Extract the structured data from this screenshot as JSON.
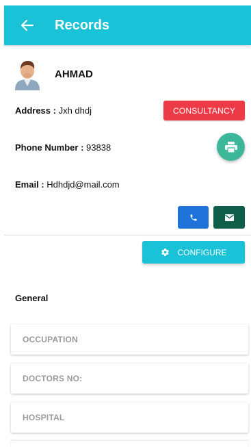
{
  "app_bar": {
    "title": "Records",
    "back_icon": "arrow-left-icon",
    "color": "#19c2d6"
  },
  "profile": {
    "name": "AHMAD",
    "address_label": "Address :",
    "address_value": " Jxh dhdj",
    "phone_label": "Phone Number :",
    "phone_value": " 93838",
    "email_label": "Email :",
    "email_value": " Hdhdjd@mail.com"
  },
  "actions": {
    "consultancy_label": "CONSULTANCY",
    "consultancy_color": "#ec3b47",
    "print_icon": "printer-icon",
    "call_icon": "phone-icon",
    "mail_icon": "mail-icon",
    "configure_label": "CONFIGURE",
    "configure_icon": "gear-icon"
  },
  "general": {
    "title": "General",
    "fields": [
      {
        "placeholder": "OCCUPATION"
      },
      {
        "placeholder": "DOCTORS NO:"
      },
      {
        "placeholder": "HOSPITAL"
      }
    ]
  }
}
